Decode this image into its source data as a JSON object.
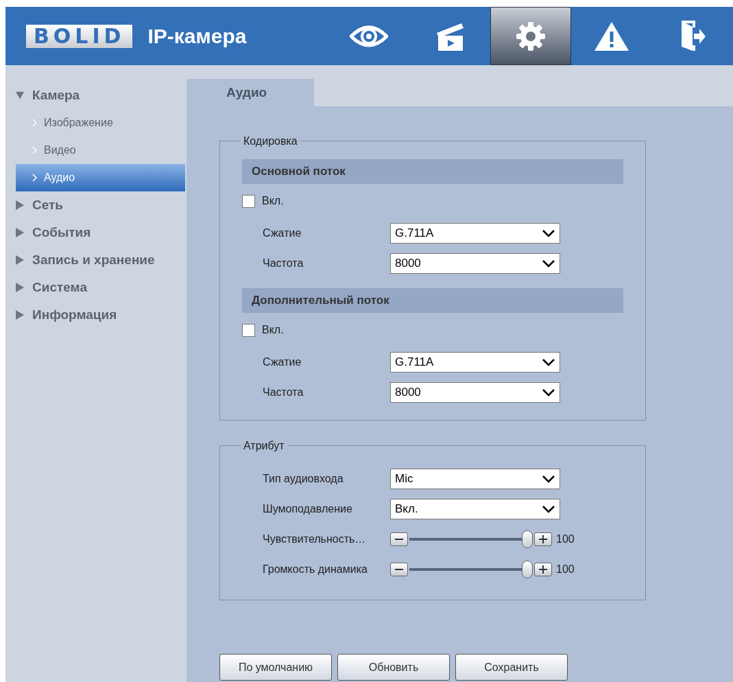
{
  "header": {
    "logo": "BOLID",
    "title": "IP-камера",
    "nav": [
      {
        "kind": "eye",
        "selected": false
      },
      {
        "kind": "clapper",
        "selected": false
      },
      {
        "kind": "gear",
        "selected": true
      },
      {
        "kind": "warning",
        "selected": false
      },
      {
        "kind": "exit",
        "selected": false
      }
    ]
  },
  "sidebar": {
    "items": [
      {
        "label": "Камера",
        "expanded": true,
        "children": [
          {
            "label": "Изображение",
            "selected": false
          },
          {
            "label": "Видео",
            "selected": false
          },
          {
            "label": "Аудио",
            "selected": true
          }
        ]
      },
      {
        "label": "Сеть",
        "expanded": false
      },
      {
        "label": "События",
        "expanded": false
      },
      {
        "label": "Запись и хранение",
        "expanded": false
      },
      {
        "label": "Система",
        "expanded": false
      },
      {
        "label": "Информация",
        "expanded": false
      }
    ]
  },
  "tabs": [
    {
      "label": "Аудио",
      "selected": true
    }
  ],
  "encoding": {
    "legend": "Кодировка",
    "streams": [
      {
        "title": "Основной поток",
        "enable": {
          "label": "Вкл.",
          "checked": false
        },
        "fields": [
          {
            "label": "Сжатие",
            "value": "G.711A"
          },
          {
            "label": "Частота",
            "value": "8000"
          }
        ]
      },
      {
        "title": "Дополнительный поток",
        "enable": {
          "label": "Вкл.",
          "checked": false
        },
        "fields": [
          {
            "label": "Сжатие",
            "value": "G.711A"
          },
          {
            "label": "Частота",
            "value": "8000"
          }
        ]
      }
    ]
  },
  "attribute": {
    "legend": "Атрибут",
    "rows": [
      {
        "kind": "select",
        "label": "Тип аудиовхода",
        "value": "Mic"
      },
      {
        "kind": "select",
        "label": "Шумоподавление",
        "value": "Вкл."
      },
      {
        "kind": "slider",
        "label": "Чувствительность…",
        "level": 1,
        "reading": "100"
      },
      {
        "kind": "slider",
        "label": "Громкость динамика",
        "level": 1,
        "reading": "100"
      }
    ]
  },
  "buttons": [
    "По умолчанию",
    "Обновить",
    "Сохранить"
  ]
}
